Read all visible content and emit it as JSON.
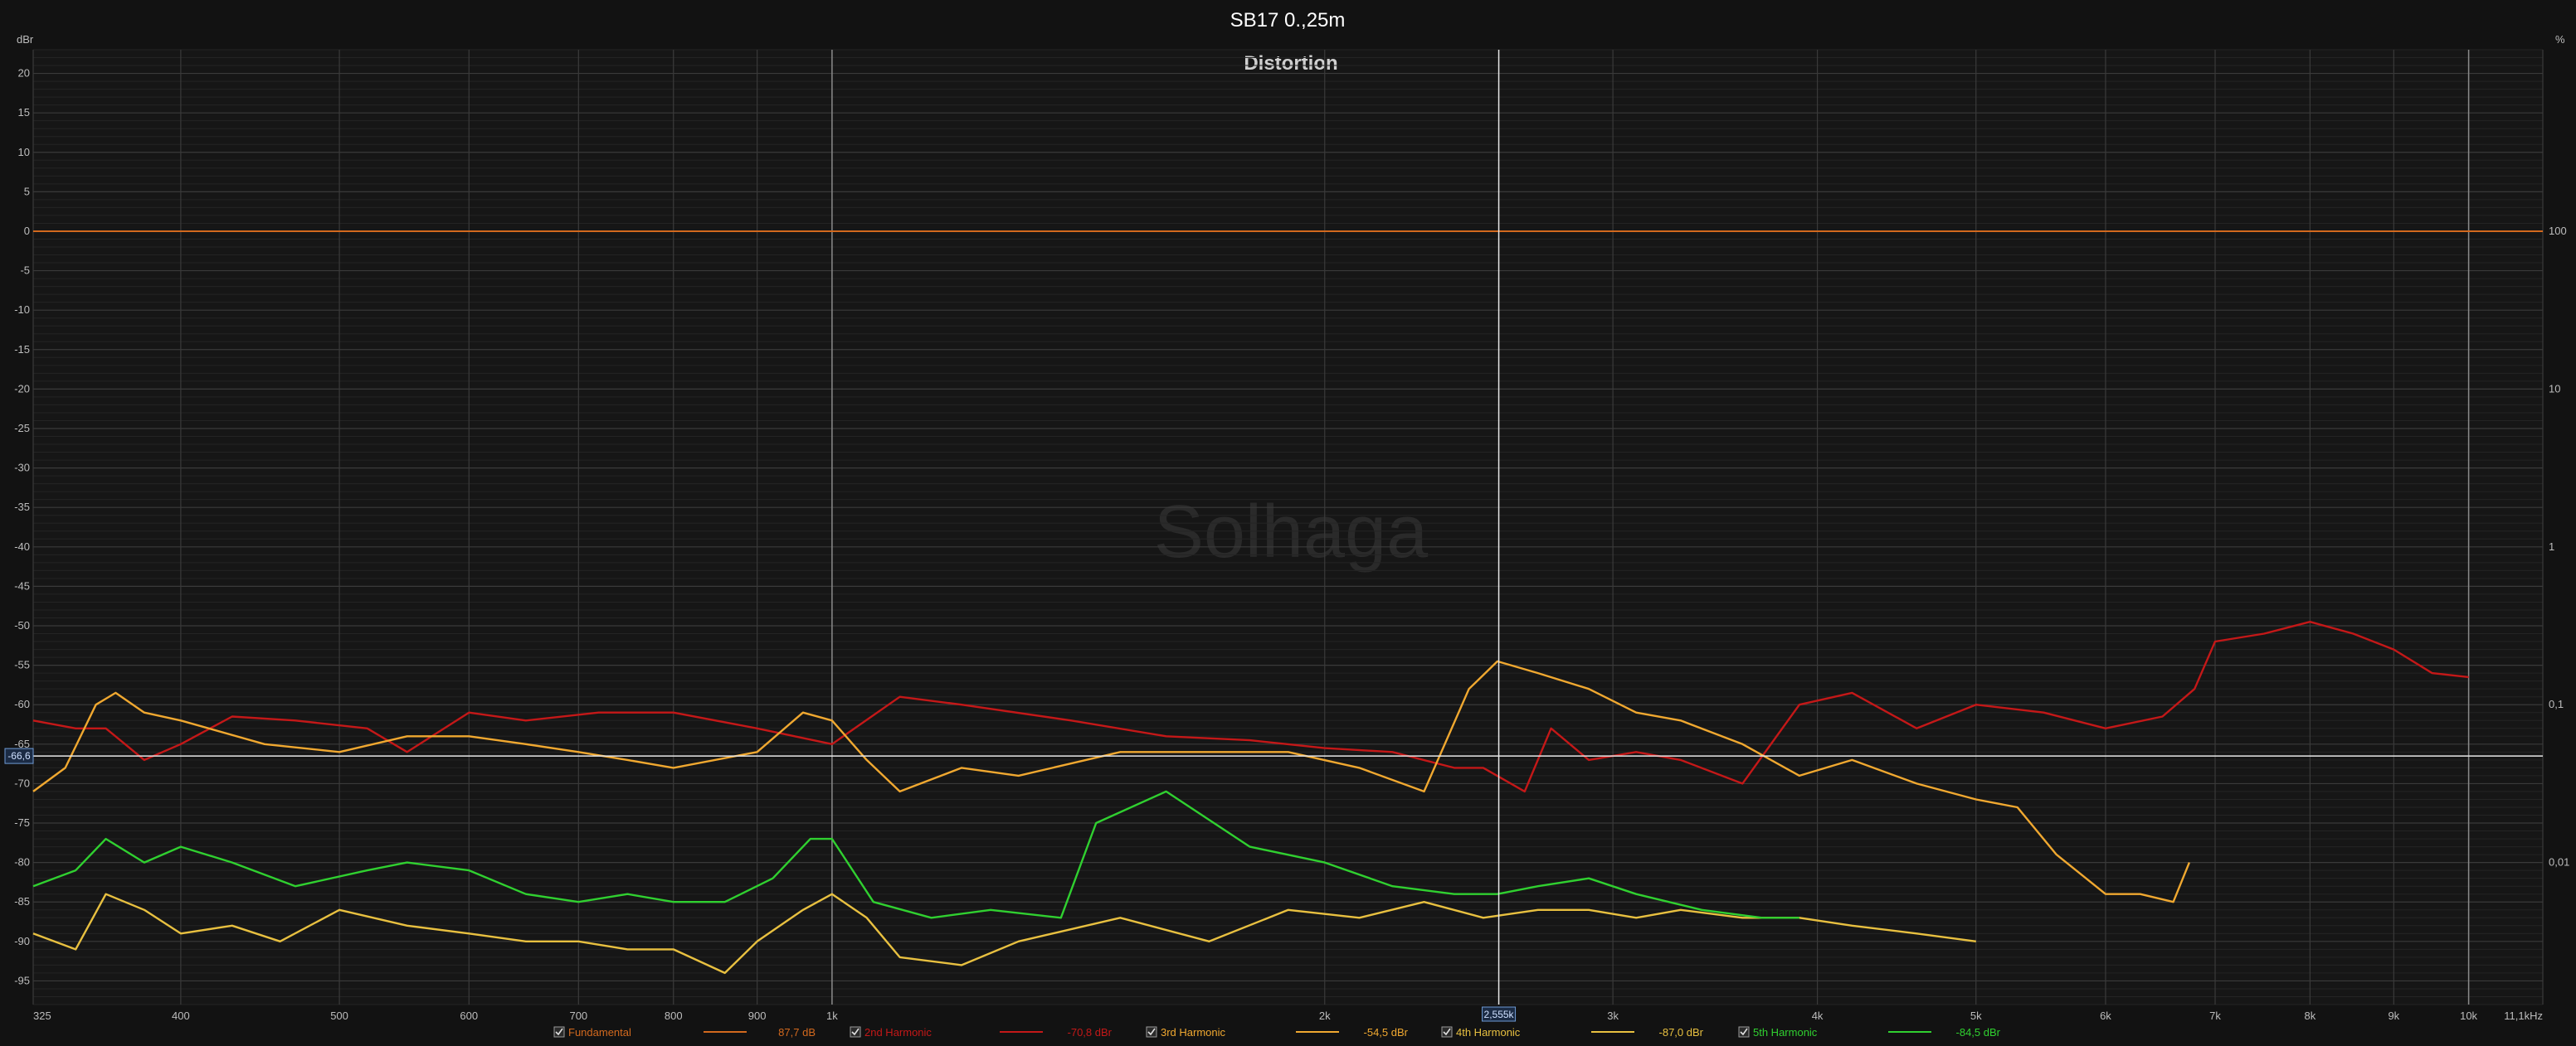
{
  "chart_data": {
    "type": "line",
    "title": "SB17 0.,25m",
    "subtitle": "Distortion",
    "watermark": "Solhaga",
    "xlabel": "",
    "ylabel_left": "dBr",
    "ylabel_right": "%",
    "xscale": "log",
    "xlim": [
      325,
      11100
    ],
    "ylim": [
      -98,
      23
    ],
    "grid": true,
    "x_ticks": [
      {
        "v": 325,
        "label": "325"
      },
      {
        "v": 400,
        "label": "400"
      },
      {
        "v": 500,
        "label": "500"
      },
      {
        "v": 600,
        "label": "600"
      },
      {
        "v": 700,
        "label": "700"
      },
      {
        "v": 800,
        "label": "800"
      },
      {
        "v": 900,
        "label": "900"
      },
      {
        "v": 1000,
        "label": "1k"
      },
      {
        "v": 2000,
        "label": "2k"
      },
      {
        "v": 3000,
        "label": "3k"
      },
      {
        "v": 4000,
        "label": "4k"
      },
      {
        "v": 5000,
        "label": "5k"
      },
      {
        "v": 6000,
        "label": "6k"
      },
      {
        "v": 7000,
        "label": "7k"
      },
      {
        "v": 8000,
        "label": "8k"
      },
      {
        "v": 9000,
        "label": "9k"
      },
      {
        "v": 10000,
        "label": "10k"
      },
      {
        "v": 11100,
        "label": "11,1kHz"
      }
    ],
    "y_ticks": [
      20,
      15,
      10,
      5,
      0,
      -5,
      -10,
      -15,
      -20,
      -25,
      -30,
      -35,
      -40,
      -45,
      -50,
      -55,
      -60,
      -65,
      -70,
      -75,
      -80,
      -85,
      -90,
      -95
    ],
    "y_tick_labels": [
      "20",
      "15",
      "10",
      "5",
      "0",
      "-5",
      "-10",
      "-15",
      "-20",
      "-25",
      "-30",
      "-35",
      "-40",
      "-45",
      "-50",
      "-55",
      "-60",
      "-65",
      "-70",
      "-75",
      "-80",
      "-85",
      "-90",
      "-95"
    ],
    "y2_ticks": [
      {
        "v": 0,
        "label": "100"
      },
      {
        "v": -20,
        "label": "10"
      },
      {
        "v": -40,
        "label": "1"
      },
      {
        "v": -60,
        "label": "0,1"
      },
      {
        "v": -80,
        "label": "0,01"
      }
    ],
    "cursor": {
      "x": 2555,
      "y": -66.5,
      "x_label": "2,555k",
      "y_label": "-66,6"
    },
    "series": [
      {
        "name": "Fundamental",
        "value_label": "87,7 dB",
        "color": "#d2691e",
        "x": [
          325,
          11100
        ],
        "y": [
          0,
          0
        ]
      },
      {
        "name": "2nd Harmonic",
        "value_label": "-70,8 dBr",
        "color": "#c41818",
        "x": [
          325,
          345,
          360,
          380,
          400,
          430,
          470,
          520,
          550,
          600,
          650,
          720,
          800,
          900,
          1000,
          1100,
          1200,
          1400,
          1600,
          1800,
          2000,
          2200,
          2400,
          2500,
          2650,
          2750,
          2900,
          3100,
          3300,
          3600,
          3900,
          4200,
          4600,
          5000,
          5500,
          6000,
          6500,
          6800,
          7000,
          7500,
          8000,
          8500,
          9000,
          9500,
          10000
        ],
        "y": [
          -62,
          -63,
          -63,
          -67,
          -65,
          -61.5,
          -62,
          -63,
          -66,
          -61,
          -62,
          -61,
          -61,
          -63,
          -65,
          -59,
          -60,
          -62,
          -64,
          -64.5,
          -65.5,
          -66,
          -68,
          -68,
          -71,
          -63,
          -67,
          -66,
          -67,
          -70,
          -60,
          -58.5,
          -63,
          -60,
          -61,
          -63,
          -61.5,
          -58,
          -52,
          -51,
          -49.5,
          -51,
          -53,
          -56,
          -56.5
        ]
      },
      {
        "name": "3rd Harmonic",
        "value_label": "-54,5 dBr",
        "color": "#f0a830",
        "x": [
          325,
          340,
          355,
          365,
          380,
          400,
          450,
          500,
          550,
          600,
          650,
          700,
          750,
          800,
          900,
          960,
          1000,
          1050,
          1100,
          1200,
          1300,
          1500,
          1700,
          1900,
          2100,
          2300,
          2450,
          2550,
          2700,
          2900,
          3100,
          3300,
          3600,
          3900,
          4200,
          4600,
          5000,
          5300,
          5600,
          6000,
          6300,
          6600,
          6750
        ],
        "y": [
          -71,
          -68,
          -60,
          -58.5,
          -61,
          -62,
          -65,
          -66,
          -64,
          -64,
          -65,
          -66,
          -67,
          -68,
          -66,
          -61,
          -62,
          -67,
          -71,
          -68,
          -69,
          -66,
          -66,
          -66,
          -68,
          -71,
          -58,
          -54.5,
          -56,
          -58,
          -61,
          -62,
          -65,
          -69,
          -67,
          -70,
          -72,
          -73,
          -79,
          -84,
          -84,
          -85,
          -80
        ]
      },
      {
        "name": "4th Harmonic",
        "value_label": "-87,0 dBr",
        "color": "#e8c040",
        "x": [
          325,
          345,
          360,
          380,
          400,
          430,
          460,
          500,
          550,
          600,
          650,
          700,
          750,
          800,
          860,
          900,
          960,
          1000,
          1050,
          1100,
          1200,
          1300,
          1500,
          1700,
          1900,
          2100,
          2300,
          2500,
          2700,
          2900,
          3100,
          3300,
          3600,
          3900,
          4200,
          4600,
          5000
        ],
        "y": [
          -89,
          -91,
          -84,
          -86,
          -89,
          -88,
          -90,
          -86,
          -88,
          -89,
          -90,
          -90,
          -91,
          -91,
          -94,
          -90,
          -86,
          -84,
          -87,
          -92,
          -93,
          -90,
          -87,
          -90,
          -86,
          -87,
          -85,
          -87,
          -86,
          -86,
          -87,
          -86,
          -87,
          -87,
          -88,
          -89,
          -90
        ]
      },
      {
        "name": "5th Harmonic",
        "value_label": "-84,5 dBr",
        "color": "#30d030",
        "x": [
          325,
          345,
          360,
          380,
          400,
          430,
          470,
          520,
          550,
          600,
          650,
          700,
          750,
          800,
          860,
          920,
          970,
          1000,
          1060,
          1150,
          1250,
          1380,
          1450,
          1600,
          1800,
          2000,
          2200,
          2400,
          2550,
          2700,
          2900,
          3100,
          3400,
          3700,
          3900
        ],
        "y": [
          -83,
          -81,
          -77,
          -80,
          -78,
          -80,
          -83,
          -81,
          -80,
          -81,
          -84,
          -85,
          -84,
          -85,
          -85,
          -82,
          -77,
          -77,
          -85,
          -87,
          -86,
          -87,
          -75,
          -71,
          -78,
          -80,
          -83,
          -84,
          -84,
          -83,
          -82,
          -84,
          -86,
          -87,
          -87
        ]
      }
    ],
    "legend_placement": "bottom"
  }
}
